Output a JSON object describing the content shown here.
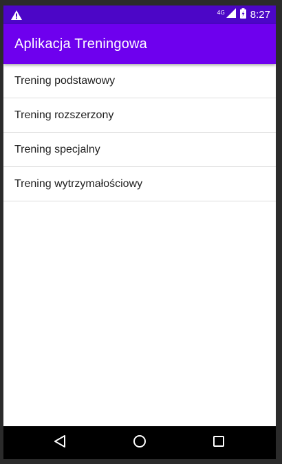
{
  "status_bar": {
    "warning_icon": "warning-triangle-icon",
    "network_label": "4G",
    "signal_icon": "cell-signal-icon",
    "battery_icon": "battery-charging-icon",
    "time": "8:27",
    "background": "#4c06c7"
  },
  "app_bar": {
    "title": "Aplikacja Treningowa",
    "background": "#6e00ee"
  },
  "list": {
    "items": [
      {
        "label": "Trening podstawowy"
      },
      {
        "label": "Trening rozszerzony"
      },
      {
        "label": "Trening specjalny"
      },
      {
        "label": "Trening wytrzymałościowy"
      }
    ]
  },
  "nav_bar": {
    "back_icon": "back-triangle-icon",
    "home_icon": "home-circle-icon",
    "recents_icon": "recents-square-icon"
  }
}
